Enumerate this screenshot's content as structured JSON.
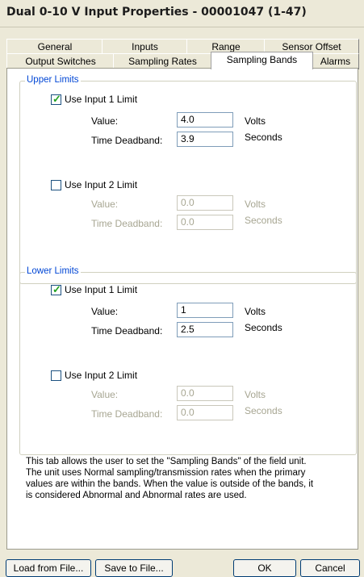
{
  "window": {
    "title": "Dual 0-10 V Input Properties - 00001047 (1-47)"
  },
  "tabs_row1": [
    "General",
    "Inputs",
    "Range",
    "Sensor Offset"
  ],
  "tabs_row2": [
    "Output Switches",
    "Sampling Rates",
    "Sampling Bands",
    "Alarms"
  ],
  "active_tab": "Sampling Bands",
  "upper": {
    "label": "Upper Limits",
    "input1": {
      "checkbox_label": "Use Input 1 Limit",
      "checked": true,
      "value_label": "Value:",
      "value": "4.0",
      "value_unit": "Volts",
      "deadband_label": "Time Deadband:",
      "deadband": "3.9",
      "deadband_unit": "Seconds"
    },
    "input2": {
      "checkbox_label": "Use Input 2 Limit",
      "checked": false,
      "value_label": "Value:",
      "value": "0.0",
      "value_unit": "Volts",
      "deadband_label": "Time Deadband:",
      "deadband": "0.0",
      "deadband_unit": "Seconds"
    }
  },
  "lower": {
    "label": "Lower Limits",
    "input1": {
      "checkbox_label": "Use Input 1 Limit",
      "checked": true,
      "value_label": "Value:",
      "value": "1",
      "value_unit": "Volts",
      "deadband_label": "Time Deadband:",
      "deadband": "2.5",
      "deadband_unit": "Seconds"
    },
    "input2": {
      "checkbox_label": "Use Input 2 Limit",
      "checked": false,
      "value_label": "Value:",
      "value": "0.0",
      "value_unit": "Volts",
      "deadband_label": "Time Deadband:",
      "deadband": "0.0",
      "deadband_unit": "Seconds"
    }
  },
  "description": [
    "This tab allows the user to set the \"Sampling Bands\" of the field unit.",
    "The unit uses Normal sampling/transmission rates when the primary",
    "values are within the bands.  When the value is outside of the bands, it",
    "is considered Abnormal and Abnormal rates are used."
  ],
  "buttons": {
    "load": "Load from File...",
    "save": "Save to File...",
    "ok": "OK",
    "cancel": "Cancel"
  }
}
